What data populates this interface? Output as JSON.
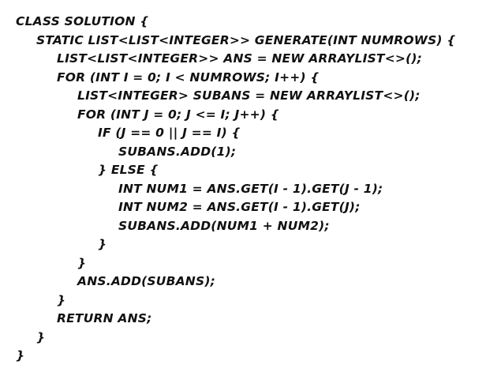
{
  "code": {
    "lines": [
      {
        "indent": 0,
        "text": "CLASS SOLUTION {"
      },
      {
        "indent": 1,
        "text": "STATIC LIST<LIST<INTEGER>> GENERATE(INT NUMROWS) {"
      },
      {
        "indent": 2,
        "text": "LIST<LIST<INTEGER>> ANS = NEW ARRAYLIST<>();"
      },
      {
        "indent": 2,
        "text": "FOR (INT I = 0; I < NUMROWS; I++) {"
      },
      {
        "indent": 3,
        "text": "LIST<INTEGER> SUBANS = NEW ARRAYLIST<>();"
      },
      {
        "indent": 3,
        "text": "FOR (INT J = 0; J <= I; J++) {"
      },
      {
        "indent": 4,
        "text": "IF (J == 0 || J == I) {"
      },
      {
        "indent": 5,
        "text": "SUBANS.ADD(1);"
      },
      {
        "indent": 4,
        "text": "} ELSE {"
      },
      {
        "indent": 5,
        "text": "INT NUM1 = ANS.GET(I - 1).GET(J - 1);"
      },
      {
        "indent": 5,
        "text": "INT NUM2 = ANS.GET(I - 1).GET(J);"
      },
      {
        "indent": 5,
        "text": "SUBANS.ADD(NUM1 + NUM2);"
      },
      {
        "indent": 4,
        "text": "}"
      },
      {
        "indent": 3,
        "text": "}"
      },
      {
        "indent": 3,
        "text": "ANS.ADD(SUBANS);"
      },
      {
        "indent": 2,
        "text": "}"
      },
      {
        "indent": 2,
        "text": "RETURN ANS;"
      },
      {
        "indent": 1,
        "text": "}"
      },
      {
        "indent": 0,
        "text": "}"
      }
    ]
  }
}
